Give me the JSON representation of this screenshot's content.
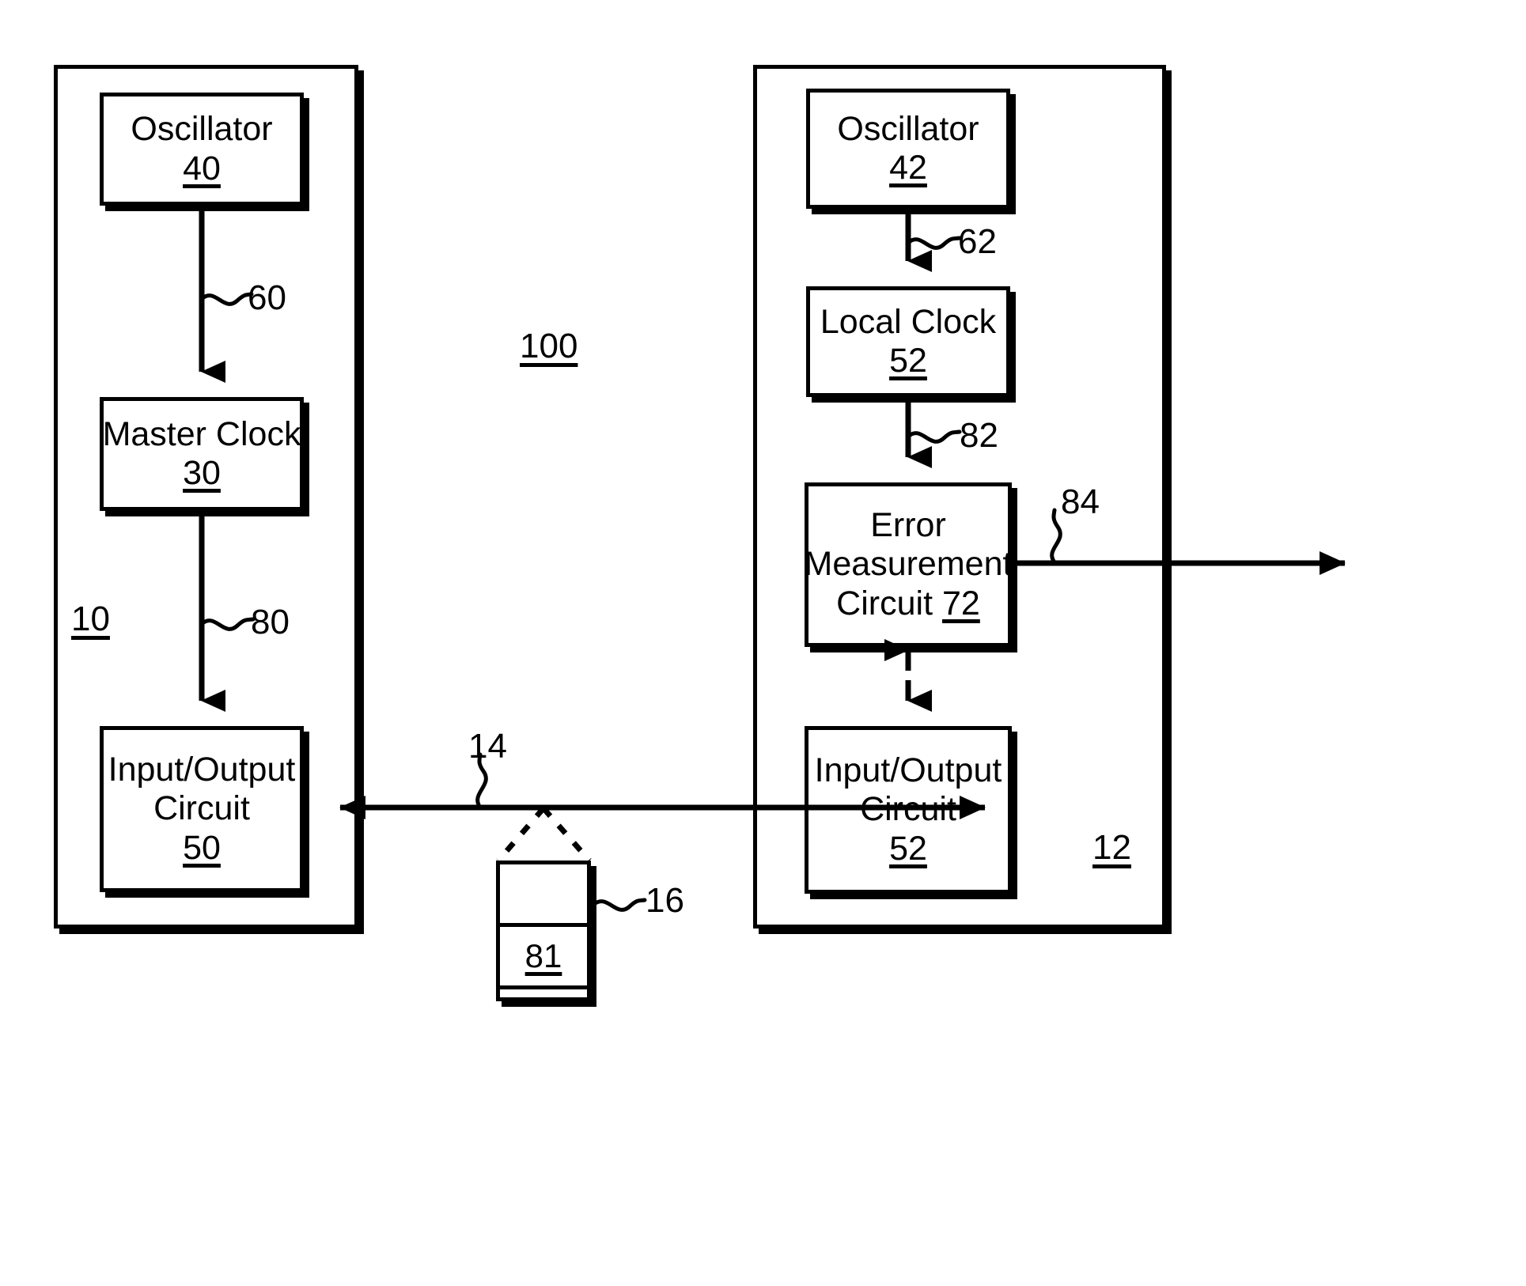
{
  "figure": {
    "system_label": "100",
    "left_system_label": "10",
    "right_system_label": "12"
  },
  "left_system": {
    "label": "10",
    "nodes": [
      {
        "id": "oscillator-40",
        "title": "Oscillator",
        "number": "40"
      },
      {
        "id": "master-clock-30",
        "title": "Master Clock",
        "number": "30"
      },
      {
        "id": "io-circuit-50",
        "title_line1": "Input/Output",
        "title_line2": "Circuit",
        "number": "50"
      }
    ],
    "connections": [
      {
        "id": "conn-60",
        "label": "60",
        "from": "oscillator-40",
        "to": "master-clock-30"
      },
      {
        "id": "conn-80",
        "label": "80",
        "from": "master-clock-30",
        "to": "io-circuit-50"
      }
    ]
  },
  "right_system": {
    "label": "12",
    "nodes": [
      {
        "id": "oscillator-42",
        "title": "Oscillator",
        "number": "42"
      },
      {
        "id": "local-clock-52",
        "title": "Local Clock",
        "number": "52"
      },
      {
        "id": "error-measurement-72",
        "title_line1": "Error",
        "title_line2": "Measurement",
        "title_line3": "Circuit",
        "number": "72"
      },
      {
        "id": "io-circuit-52",
        "title_line1": "Input/Output",
        "title_line2": "Circuit",
        "number": "52"
      }
    ],
    "connections": [
      {
        "id": "conn-62",
        "label": "62",
        "from": "oscillator-42",
        "to": "local-clock-52"
      },
      {
        "id": "conn-82",
        "label": "82",
        "from": "local-clock-52",
        "to": "error-measurement-72"
      },
      {
        "id": "conn-84",
        "label": "84",
        "from": "error-measurement-72",
        "to": "external-output"
      }
    ]
  },
  "link": {
    "label": "14",
    "description_from": "io-circuit-50",
    "description_to": "io-circuit-52"
  },
  "packet": {
    "label": "16",
    "field_label": "81"
  },
  "colors": {
    "ink": "#000000",
    "paper": "#ffffff"
  }
}
